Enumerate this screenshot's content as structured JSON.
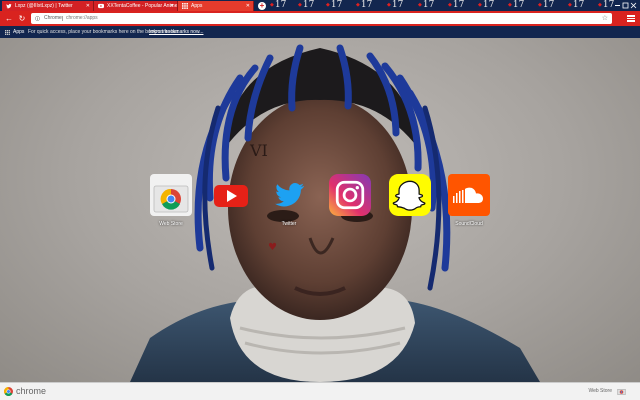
{
  "tabs": [
    {
      "title": "Lxpz (@IIIxtLxpz) | Twitter",
      "icon": "twitter-icon"
    },
    {
      "title": "XXTentaCoffee - Popular Anime",
      "icon": "youtube-icon"
    },
    {
      "title": "Apps",
      "icon": "apps-icon"
    }
  ],
  "tab_numbers": [
    "17",
    "17",
    "17",
    "17",
    "17",
    "17",
    "17",
    "17",
    "17",
    "17",
    "17",
    "17",
    "17"
  ],
  "toolbar": {
    "chrome_label": "Chrome",
    "url": "chrome://apps"
  },
  "bookmarks": {
    "apps_label": "Apps",
    "message": "For quick access, place your bookmarks here on the bookmarks bar.",
    "import_link": "Import bookmarks now..."
  },
  "apps": [
    {
      "name": "Web Store",
      "icon": "webstore-icon",
      "color": "#ffffff"
    },
    {
      "name": "",
      "icon": "youtube-icon",
      "color": "#e62117"
    },
    {
      "name": "Twitter",
      "icon": "twitter-icon",
      "color": "#1da1f2"
    },
    {
      "name": "",
      "icon": "instagram-icon",
      "color": "#c13584"
    },
    {
      "name": "",
      "icon": "snapchat-icon",
      "color": "#fffc00"
    },
    {
      "name": "SoundCloud",
      "icon": "soundcloud-icon",
      "color": "#ff5500"
    }
  ],
  "footer": {
    "brand": "chrome",
    "webstore_label": "Web Store"
  },
  "theme": {
    "accent": "#d9231f",
    "tabbar": "#12264f"
  }
}
